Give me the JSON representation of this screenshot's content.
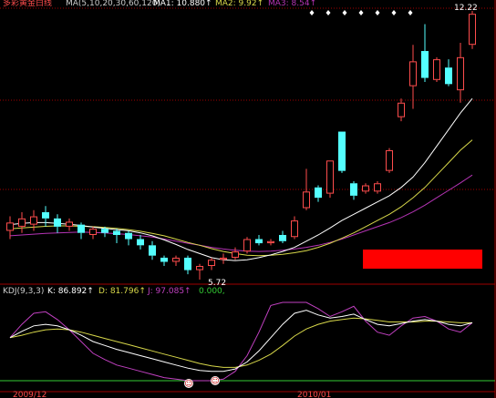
{
  "main_header": {
    "title": "多彩黄金白线",
    "ma_label": "MA(5,10,20,30,60,120)",
    "ma1": "MA1: 10.880↑",
    "ma2": "MA2: 9.92↑",
    "ma3": "MA3: 8.54↑"
  },
  "kdj_header": {
    "label": "KDJ(9,3,3)",
    "k": "K: 86.892↑",
    "d": "D: 81.796↑",
    "j": "J: 97.085↑",
    "zero": "0.000,"
  },
  "annotations": {
    "high_price": "12.22",
    "low_price": "5.72",
    "date_left": "2009/12",
    "date_right": "2010/01",
    "smiley": "☺"
  },
  "colors": {
    "background": "#000000",
    "up_candle": "#ff4d4d",
    "down_candle": "#54ffff",
    "ma_white": "#ffffff",
    "ma_yellow": "#d8d84a",
    "ma_purple": "#b534b5",
    "grid": "#a00000",
    "zero_line": "#33cc33",
    "red_block": "#ff0000"
  },
  "chart_data": {
    "type": "candlestick",
    "price_range": [
      5.72,
      12.22
    ],
    "candles": [
      {
        "o": 6.9,
        "c": 7.1,
        "h": 7.25,
        "l": 6.7
      },
      {
        "o": 7.0,
        "c": 7.2,
        "h": 7.35,
        "l": 6.85
      },
      {
        "o": 7.05,
        "c": 7.25,
        "h": 7.4,
        "l": 6.9
      },
      {
        "o": 7.35,
        "c": 7.2,
        "h": 7.5,
        "l": 7.0
      },
      {
        "o": 7.2,
        "c": 7.0,
        "h": 7.3,
        "l": 6.85
      },
      {
        "o": 7.0,
        "c": 7.12,
        "h": 7.2,
        "l": 6.9
      },
      {
        "o": 7.05,
        "c": 6.85,
        "h": 7.1,
        "l": 6.7
      },
      {
        "o": 6.8,
        "c": 6.95,
        "h": 7.0,
        "l": 6.7
      },
      {
        "o": 6.95,
        "c": 6.85,
        "h": 7.0,
        "l": 6.75
      },
      {
        "o": 6.9,
        "c": 6.8,
        "h": 6.95,
        "l": 6.6
      },
      {
        "o": 6.85,
        "c": 6.7,
        "h": 6.9,
        "l": 6.55
      },
      {
        "o": 6.7,
        "c": 6.55,
        "h": 6.8,
        "l": 6.45
      },
      {
        "o": 6.55,
        "c": 6.3,
        "h": 6.65,
        "l": 6.2
      },
      {
        "o": 6.25,
        "c": 6.15,
        "h": 6.3,
        "l": 6.05
      },
      {
        "o": 6.15,
        "c": 6.25,
        "h": 6.3,
        "l": 6.05
      },
      {
        "o": 6.25,
        "c": 5.95,
        "h": 6.3,
        "l": 5.85
      },
      {
        "o": 5.95,
        "c": 6.05,
        "h": 6.1,
        "l": 5.72
      },
      {
        "o": 6.05,
        "c": 6.2,
        "h": 6.25,
        "l": 5.95
      },
      {
        "o": 6.2,
        "c": 6.25,
        "h": 6.35,
        "l": 6.1
      },
      {
        "o": 6.25,
        "c": 6.4,
        "h": 6.5,
        "l": 6.2
      },
      {
        "o": 6.4,
        "c": 6.7,
        "h": 6.75,
        "l": 6.35
      },
      {
        "o": 6.7,
        "c": 6.6,
        "h": 6.8,
        "l": 6.55
      },
      {
        "o": 6.6,
        "c": 6.65,
        "h": 6.7,
        "l": 6.55
      },
      {
        "o": 6.8,
        "c": 6.65,
        "h": 6.9,
        "l": 6.6
      },
      {
        "o": 6.75,
        "c": 7.15,
        "h": 7.25,
        "l": 6.7
      },
      {
        "o": 7.45,
        "c": 7.85,
        "h": 8.4,
        "l": 7.4
      },
      {
        "o": 7.95,
        "c": 7.7,
        "h": 8.0,
        "l": 7.6
      },
      {
        "o": 7.8,
        "c": 8.6,
        "h": 8.6,
        "l": 7.7
      },
      {
        "o": 9.3,
        "c": 8.35,
        "h": 9.3,
        "l": 8.3
      },
      {
        "o": 8.05,
        "c": 7.75,
        "h": 8.1,
        "l": 7.65
      },
      {
        "o": 7.85,
        "c": 8.0,
        "h": 8.05,
        "l": 7.8
      },
      {
        "o": 7.85,
        "c": 8.05,
        "h": 8.1,
        "l": 7.8
      },
      {
        "o": 8.35,
        "c": 8.85,
        "h": 8.9,
        "l": 8.3
      },
      {
        "o": 9.65,
        "c": 10.0,
        "h": 10.1,
        "l": 9.55
      },
      {
        "o": 10.4,
        "c": 11.0,
        "h": 11.4,
        "l": 9.85
      },
      {
        "o": 11.25,
        "c": 10.6,
        "h": 11.9,
        "l": 10.5
      },
      {
        "o": 10.55,
        "c": 11.05,
        "h": 11.1,
        "l": 10.5
      },
      {
        "o": 10.85,
        "c": 10.45,
        "h": 11.05,
        "l": 10.4
      },
      {
        "o": 10.3,
        "c": 11.1,
        "h": 11.45,
        "l": 10.0
      },
      {
        "o": 11.4,
        "c": 12.15,
        "h": 12.22,
        "l": 11.3
      }
    ],
    "ma_white": [
      7.05,
      7.08,
      7.1,
      7.1,
      7.08,
      7.06,
      7.03,
      6.99,
      6.96,
      6.93,
      6.9,
      6.85,
      6.78,
      6.68,
      6.57,
      6.45,
      6.35,
      6.25,
      6.2,
      6.18,
      6.2,
      6.25,
      6.32,
      6.4,
      6.5,
      6.65,
      6.8,
      6.97,
      7.15,
      7.3,
      7.45,
      7.6,
      7.75,
      7.95,
      8.2,
      8.55,
      8.95,
      9.35,
      9.75,
      10.1
    ],
    "ma_yellow": [
      6.95,
      6.97,
      6.99,
      7.01,
      7.02,
      7.02,
      7.01,
      7.0,
      6.98,
      6.96,
      6.93,
      6.89,
      6.84,
      6.78,
      6.7,
      6.62,
      6.55,
      6.47,
      6.4,
      6.35,
      6.31,
      6.3,
      6.31,
      6.33,
      6.37,
      6.42,
      6.5,
      6.6,
      6.72,
      6.85,
      7.0,
      7.15,
      7.3,
      7.48,
      7.7,
      7.95,
      8.25,
      8.55,
      8.85,
      9.1
    ],
    "ma_purple": [
      6.78,
      6.8,
      6.82,
      6.84,
      6.85,
      6.86,
      6.87,
      6.86,
      6.85,
      6.83,
      6.81,
      6.78,
      6.75,
      6.7,
      6.65,
      6.6,
      6.55,
      6.5,
      6.46,
      6.43,
      6.41,
      6.4,
      6.41,
      6.43,
      6.46,
      6.5,
      6.55,
      6.62,
      6.7,
      6.8,
      6.9,
      7.0,
      7.1,
      7.22,
      7.36,
      7.52,
      7.7,
      7.88,
      8.06,
      8.25
    ],
    "kdj_range": [
      0,
      100
    ],
    "kdj_k": [
      55,
      63,
      70,
      72,
      70,
      65,
      58,
      50,
      45,
      40,
      36,
      32,
      28,
      24,
      20,
      16,
      13,
      12,
      12,
      15,
      24,
      38,
      55,
      72,
      86,
      90,
      84,
      80,
      82,
      85,
      78,
      72,
      70,
      73,
      76,
      78,
      76,
      72,
      70,
      74
    ],
    "kdj_d": [
      55,
      58,
      62,
      65,
      66,
      65,
      62,
      58,
      54,
      50,
      46,
      42,
      38,
      34,
      30,
      26,
      22,
      19,
      17,
      17,
      20,
      26,
      34,
      45,
      57,
      66,
      72,
      76,
      78,
      80,
      79,
      77,
      75,
      75,
      75,
      76,
      76,
      75,
      74,
      74
    ],
    "kdj_j": [
      55,
      72,
      86,
      88,
      78,
      65,
      50,
      35,
      27,
      20,
      16,
      12,
      8,
      4,
      2,
      0,
      0,
      0,
      2,
      12,
      32,
      62,
      96,
      100,
      100,
      100,
      92,
      82,
      88,
      95,
      76,
      62,
      58,
      70,
      80,
      82,
      76,
      66,
      62,
      74
    ]
  }
}
